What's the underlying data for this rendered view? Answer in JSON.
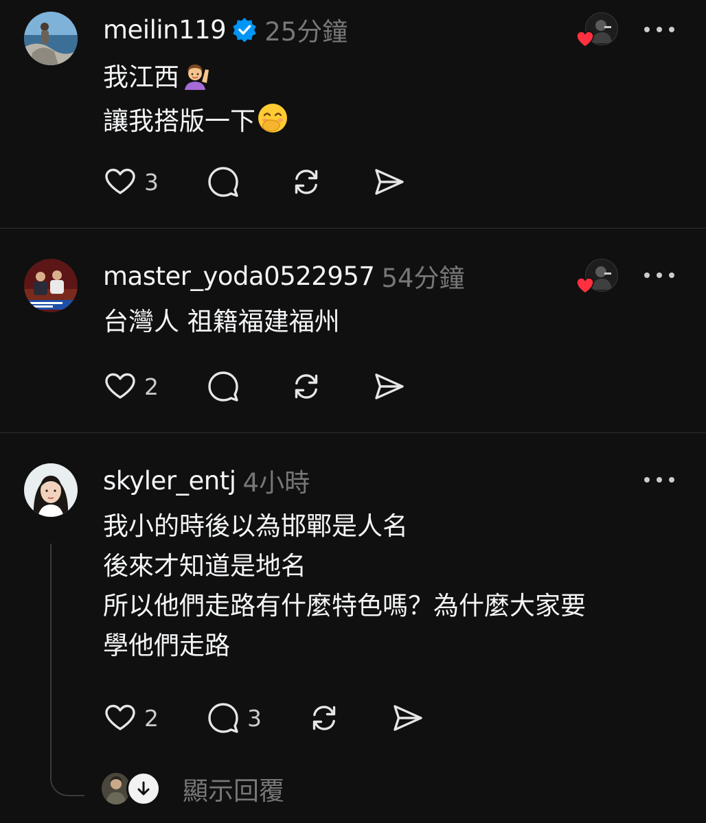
{
  "colors": {
    "background": "#101010",
    "text_primary": "#f3f5f7",
    "text_secondary": "#777777",
    "verified_blue": "#0095f6",
    "heart_red": "#ff3040"
  },
  "posts": [
    {
      "username": "meilin119",
      "verified": true,
      "time": "25分鐘",
      "lines": [
        "我江西",
        "讓我搭版一下"
      ],
      "line_emojis": [
        "🙋‍♀️",
        "🤭"
      ],
      "liked_by_author": true,
      "likes": "3",
      "replies": "",
      "icons": [
        "heart-icon",
        "comment-icon",
        "repost-icon",
        "share-icon"
      ]
    },
    {
      "username": "master_yoda0522957",
      "verified": false,
      "time": "54分鐘",
      "lines": [
        "台灣人 祖籍福建福州"
      ],
      "liked_by_author": true,
      "likes": "2",
      "replies": ""
    },
    {
      "username": "skyler_entj",
      "verified": false,
      "time": "4小時",
      "lines": [
        "我小的時後以為邯鄲是人名",
        "後來才知道是地名",
        "所以他們走路有什麼特色嗎？為什麼大家要",
        "學他們走路"
      ],
      "liked_by_author": false,
      "likes": "2",
      "replies": "3"
    }
  ],
  "thread": {
    "show_replies_label": "顯示回覆"
  }
}
